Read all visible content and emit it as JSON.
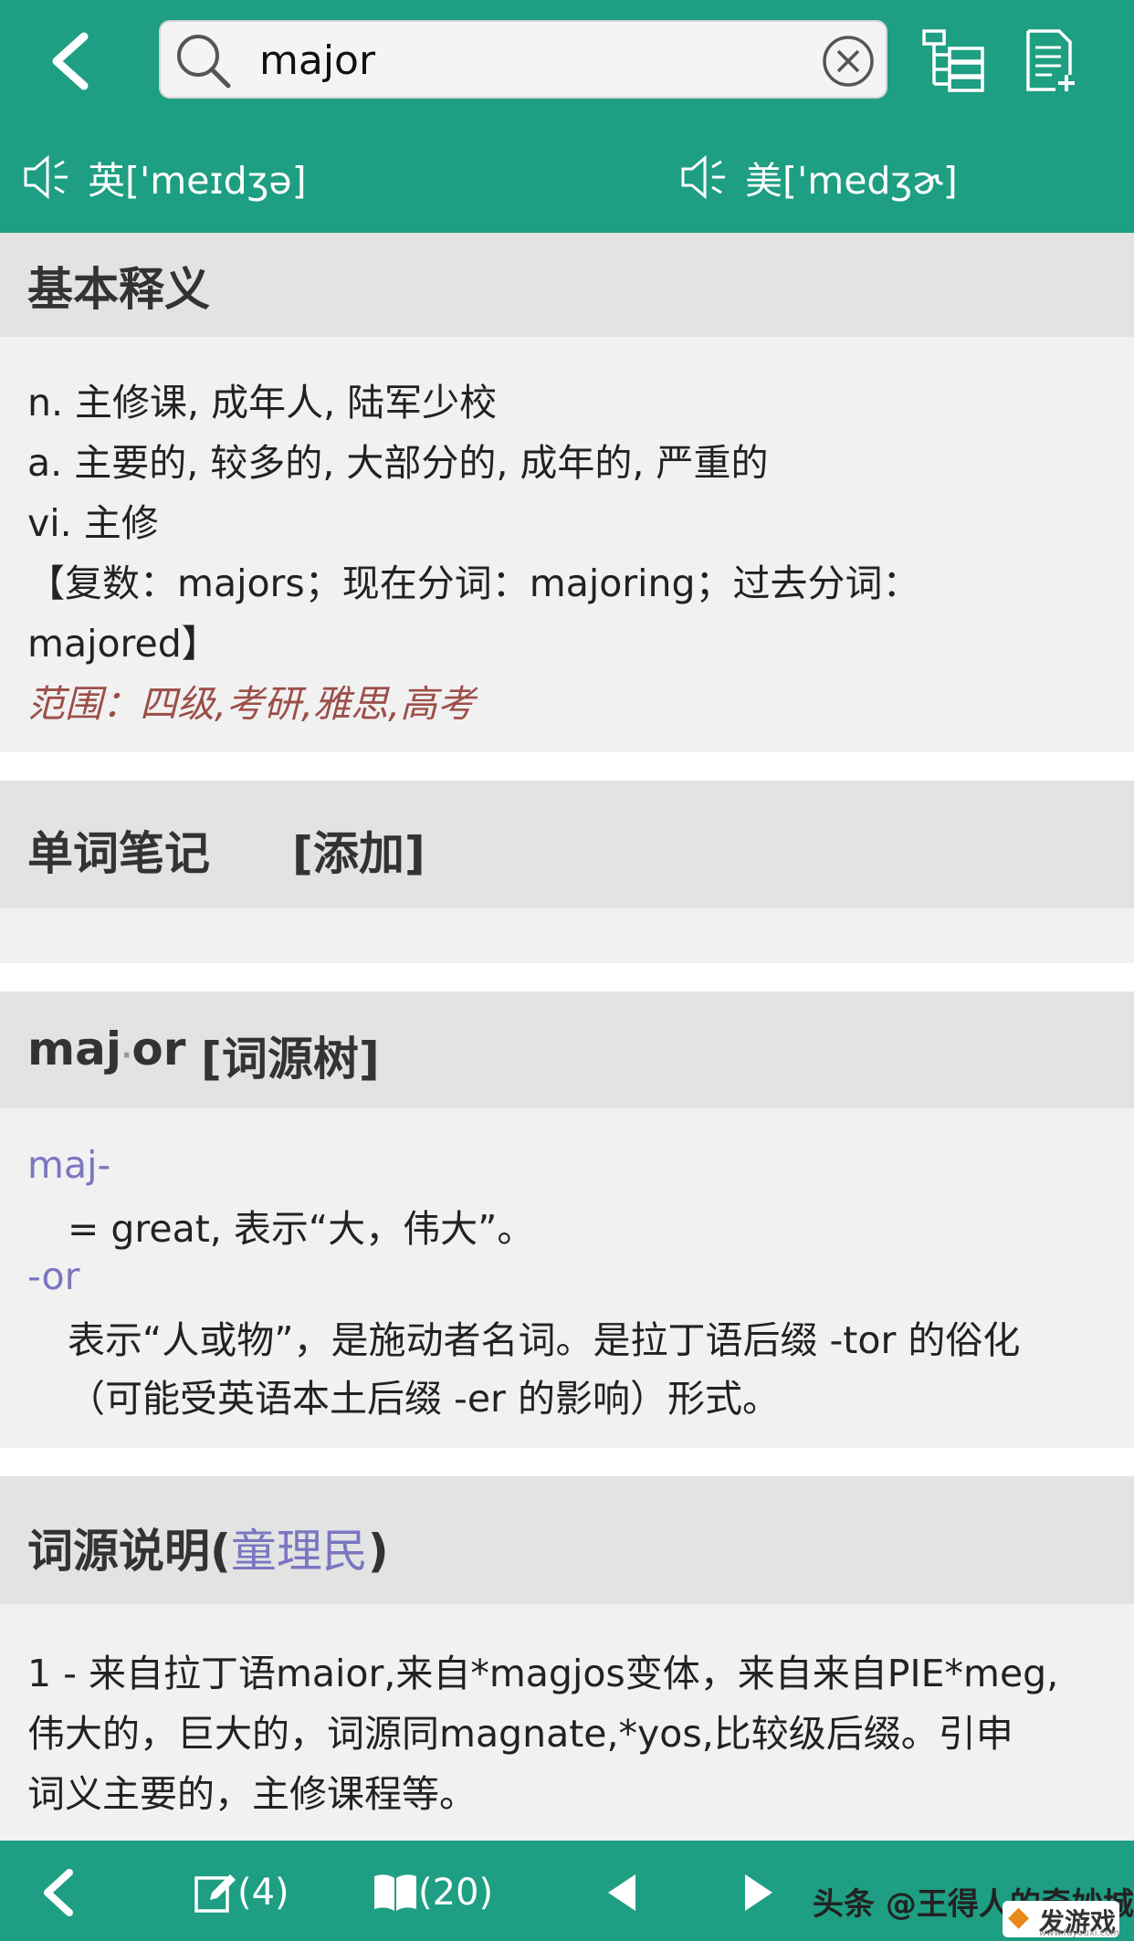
{
  "search": {
    "query": "major"
  },
  "pronunciation": {
    "uk": "英['meɪdʒə]",
    "us": "美['medʒɚ]"
  },
  "basic": {
    "title": "基本释义",
    "lines": [
      "n. 主修课, 成年人, 陆军少校",
      "a. 主要的, 较多的, 大部分的, 成年的, 严重的",
      "vi. 主修",
      "【复数：majors；现在分词：majoring；过去分词：",
      "majored】"
    ],
    "scope": "范围：四级,考研,雅思,高考"
  },
  "notes": {
    "title": "单词笔记",
    "add_link": "[添加]"
  },
  "etymology": {
    "word_part1": "maj",
    "word_dot": "·",
    "word_part2": "or",
    "tree_link": "[词源树]",
    "roots": [
      {
        "root": "maj-",
        "meaning": "= great, 表示“大，伟大”。"
      },
      {
        "root": "-or",
        "meaning_line1": "表示“人或物”，是施动者名词。是拉丁语后缀 -tor 的俗化",
        "meaning_line2": "（可能受英语本土后缀 -er 的影响）形式。"
      }
    ]
  },
  "explanation": {
    "title": "词源说明(",
    "author": "童理民",
    "title_end": ")",
    "lines": [
      "1 - 来自拉丁语maior,来自*magjos变体，来自来自PIE*meg,",
      "伟大的，巨大的，词源同magnate,*yos,比较级后缀。引申",
      "词义主要的，主修课程等。"
    ]
  },
  "bottom": {
    "notes_count": "(4)",
    "book_count": "(20)",
    "watermark": "头条 @王得人的奇妙城",
    "logo_top": "发游戏",
    "logo_url": "www.fayouxi.com"
  },
  "colors": {
    "accent": "#1e9e83",
    "link": "#7a76c0",
    "scope": "#9c4e48"
  }
}
